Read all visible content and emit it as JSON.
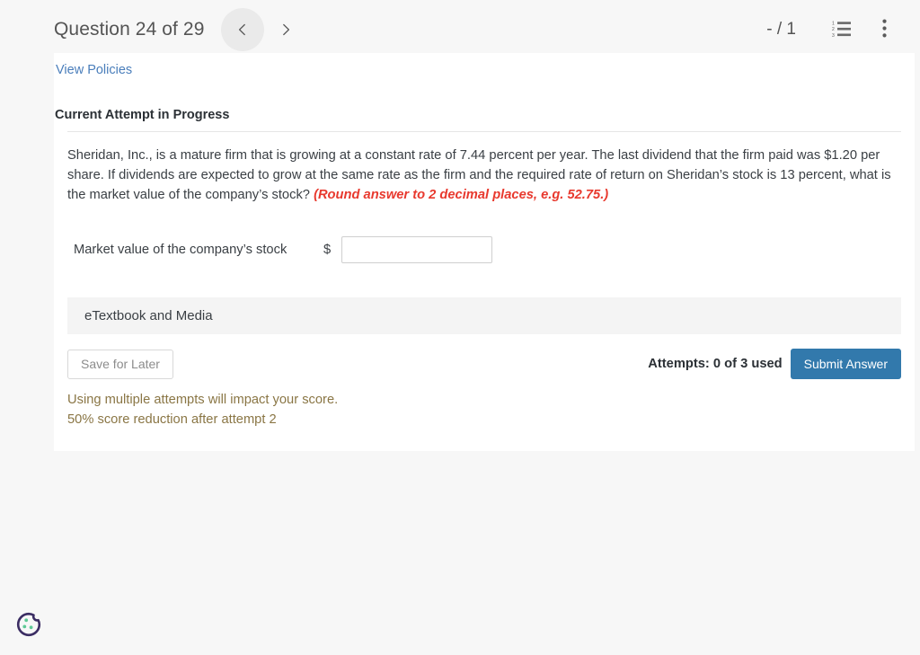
{
  "topbar": {
    "question_title": "Question 24 of 29",
    "prev_icon": "chevron-left-icon",
    "next_icon": "chevron-right-icon",
    "score": "- / 1",
    "list_icon": "numbered-list-icon",
    "menu_icon": "kebab-menu-icon"
  },
  "card": {
    "view_policies": "View Policies",
    "attempt_heading": "Current Attempt in Progress",
    "question_text": "Sheridan, Inc., is a mature firm that is growing at a constant rate of 7.44 percent per year. The last dividend that the firm paid was $1.20 per share. If dividends are expected to grow at the same rate as the firm and the required rate of return on Sheridan’s stock is 13 percent, what is the market value of the company’s stock?",
    "round_note": "(Round answer to 2 decimal places, e.g. 52.75.)",
    "answer_label": "Market value of the company’s stock",
    "currency_symbol": "$",
    "answer_value": "",
    "answer_placeholder": "",
    "etextbook_label": "eTextbook and Media",
    "save_for_later": "Save for Later",
    "attempts_text": "Attempts: 0 of 3 used",
    "submit_label": "Submit Answer",
    "warning_line_1": "Using multiple attempts will impact your score.",
    "warning_line_2": "50% score reduction after attempt 2"
  },
  "cookie": {
    "icon": "cookie-consent-icon"
  },
  "colors": {
    "link": "#4a7ebb",
    "alert_red": "#e8392e",
    "warning_olive": "#8a7645",
    "submit_blue": "#3279ac",
    "page_bg": "#f7f7f7"
  }
}
